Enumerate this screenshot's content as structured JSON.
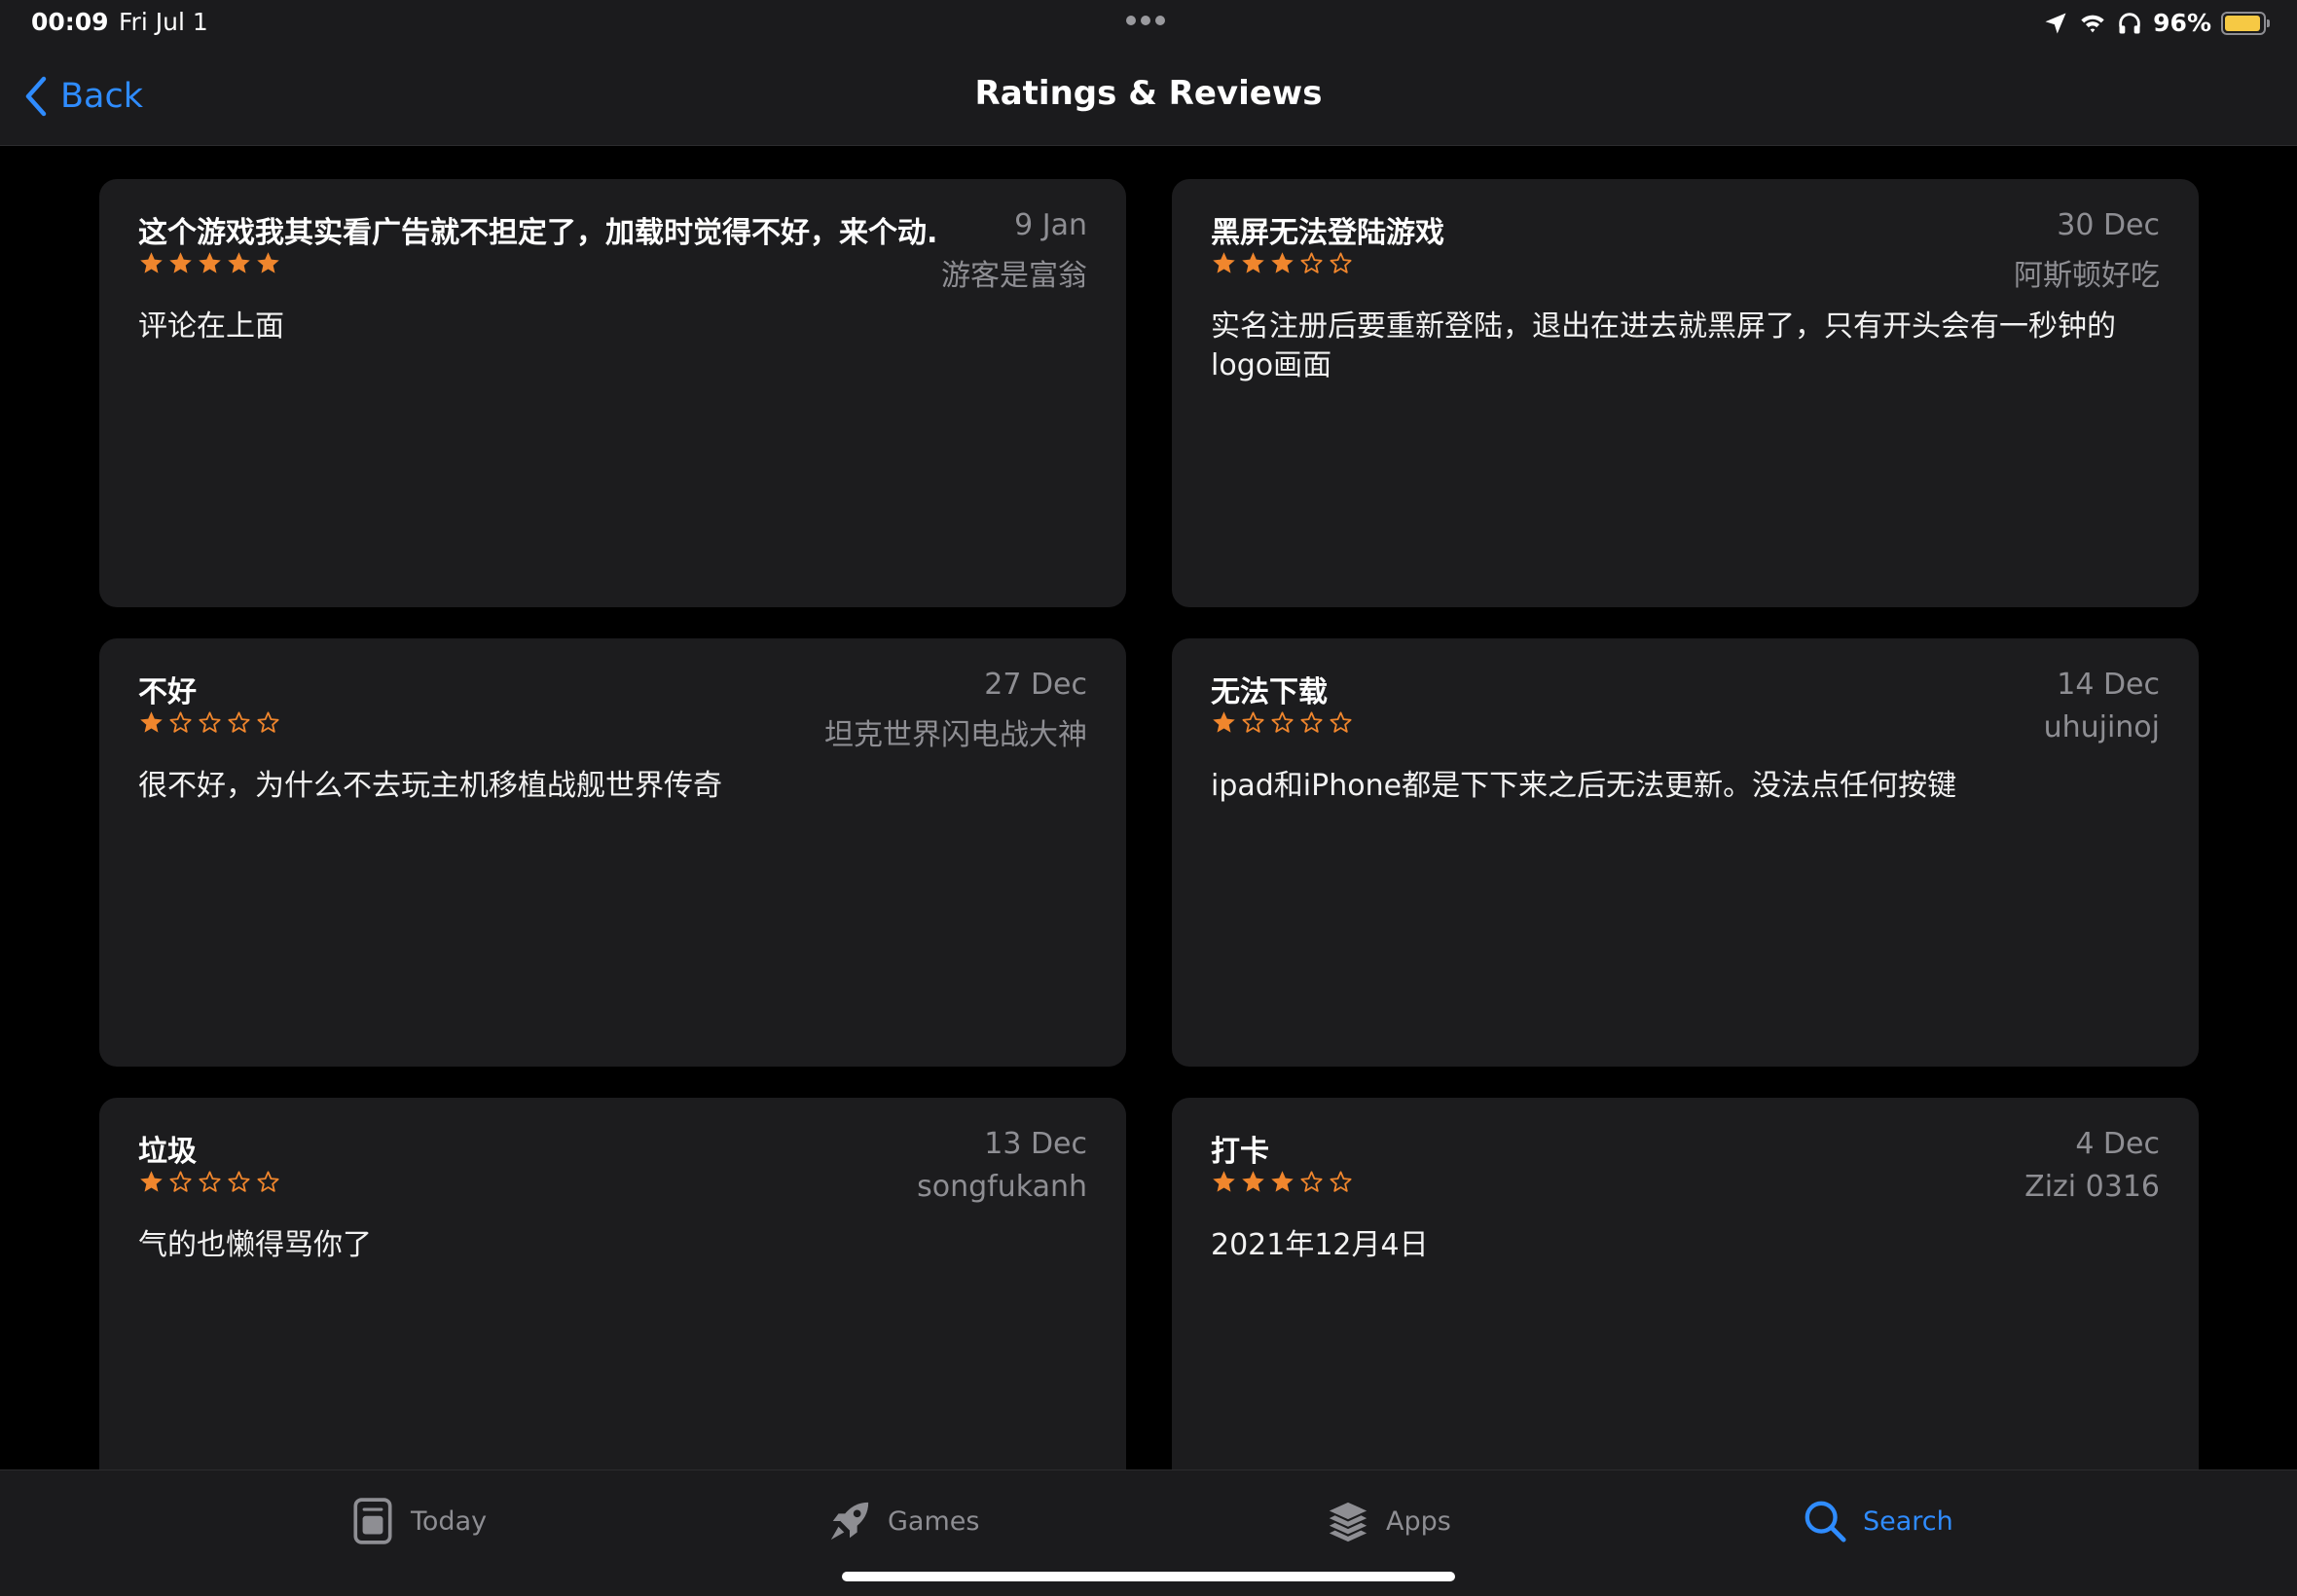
{
  "status_bar": {
    "time": "00:09",
    "date": "Fri Jul 1",
    "battery_percent": "96%",
    "battery_level": 0.96,
    "icons": [
      "location-icon",
      "wifi-icon",
      "headphones-icon",
      "battery-icon"
    ]
  },
  "nav": {
    "back_label": "Back",
    "title": "Ratings & Reviews"
  },
  "colors": {
    "accent": "#2f8cff",
    "star": "#f0862d",
    "card_bg": "#1c1c1e",
    "secondary_text": "#8e8e93"
  },
  "reviews": [
    {
      "title": "这个游戏我其实看广告就不担定了，加载时觉得不好，来个动...",
      "date": "9 Jan",
      "author": "游客是富翁",
      "rating": 5,
      "body": "评论在上面"
    },
    {
      "title": "黑屏无法登陆游戏",
      "date": "30 Dec",
      "author": "阿斯顿好吃",
      "rating": 3,
      "body": "实名注册后要重新登陆，退出在进去就黑屏了，只有开头会有一秒钟的logo画面"
    },
    {
      "title": "不好",
      "date": "27 Dec",
      "author": "坦克世界闪电战大神",
      "rating": 1,
      "body": "很不好，为什么不去玩主机移植战舰世界传奇"
    },
    {
      "title": "无法下载",
      "date": "14 Dec",
      "author": "uhujinoj",
      "rating": 1,
      "body": "ipad和iPhone都是下下来之后无法更新。没法点任何按键"
    },
    {
      "title": "垃圾",
      "date": "13 Dec",
      "author": "songfukanh",
      "rating": 1,
      "body": "气的也懒得骂你了"
    },
    {
      "title": "打卡",
      "date": "4 Dec",
      "author": "Zizi 0316",
      "rating": 3,
      "body": "2021年12月4日"
    }
  ],
  "tab_bar": {
    "tabs": [
      {
        "label": "Today",
        "icon": "today-icon",
        "active": false
      },
      {
        "label": "Games",
        "icon": "rocket-icon",
        "active": false
      },
      {
        "label": "Apps",
        "icon": "apps-stack-icon",
        "active": false
      },
      {
        "label": "Search",
        "icon": "search-icon",
        "active": true
      }
    ]
  }
}
